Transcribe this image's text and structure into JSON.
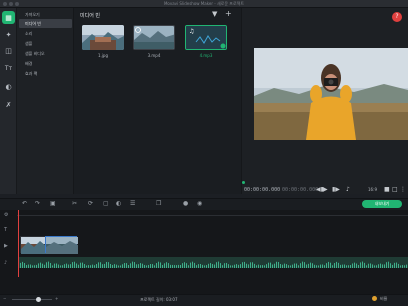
{
  "window": {
    "title": "Movavi Slideshow Maker - 새로운 프로젝트"
  },
  "categories": [
    {
      "label": "가져오기"
    },
    {
      "label": "미디어 빈"
    },
    {
      "label": "소리"
    },
    {
      "label": "샘플"
    },
    {
      "label": "샘플 비디오"
    },
    {
      "label": "배경"
    },
    {
      "label": "효과 팩"
    }
  ],
  "media": {
    "title": "미디어 빈",
    "items": [
      {
        "name": "1.jpg"
      },
      {
        "name": "3.mp4"
      },
      {
        "name": "4.mp3"
      }
    ]
  },
  "preview": {
    "time_current": "00:00:00.000",
    "time_total": "00:00:00.000",
    "aspect": "16:9"
  },
  "toolbar": {
    "export_label": "내보내기"
  },
  "status": {
    "duration": "프로젝트 길이: 03:07",
    "scale_label": "비율"
  },
  "colors": {
    "accent": "#21b573",
    "playhead": "#e0403f",
    "audio_wave": "#3fae8a"
  }
}
